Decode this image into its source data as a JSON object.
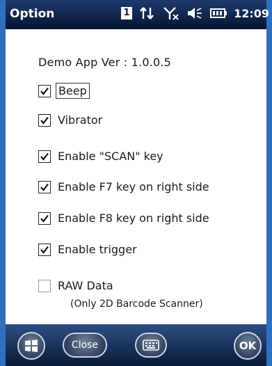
{
  "titlebar": {
    "title": "Option",
    "badge": "1",
    "clock": "12:09"
  },
  "version": "Demo App Ver : 1.0.0.5",
  "options": [
    {
      "label": "Beep",
      "checked": true
    },
    {
      "label": "Vibrator",
      "checked": true
    },
    {
      "label": "Enable \"SCAN\" key",
      "checked": true
    },
    {
      "label": "Enable F7 key on right side",
      "checked": true
    },
    {
      "label": "Enable F8 key on right side",
      "checked": true
    },
    {
      "label": "Enable trigger",
      "checked": true
    },
    {
      "label": "RAW Data",
      "checked": false
    }
  ],
  "raw_note": "(Only 2D Barcode Scanner)",
  "softkeys": {
    "close": "Close",
    "ok": "OK"
  },
  "icons": [
    "windows-start-icon",
    "keyboard-icon",
    "sync-icon",
    "no-signal-icon",
    "volume-icon",
    "battery-icon"
  ],
  "colors": {
    "titlebar": "#0a1f45",
    "frame": "#2f6fc0",
    "softbar": "#0d2550"
  }
}
